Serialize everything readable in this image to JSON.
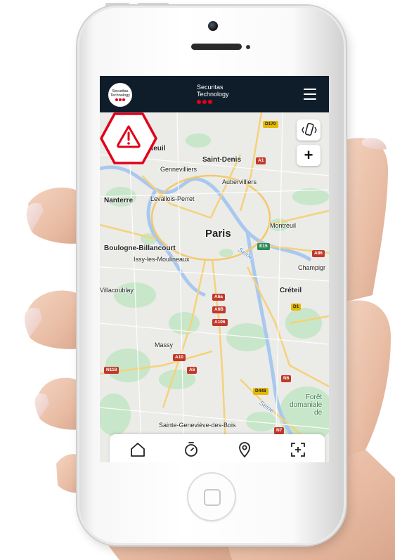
{
  "app": {
    "logo_text": "Securitas Technology",
    "brand_name": "Securitas\nTechnology",
    "brand_line1": "Securitas",
    "brand_line2": "Technology",
    "accent_color": "#e2001a",
    "header_color": "#0f1d2b"
  },
  "header": {
    "menu_icon": "hamburger-menu-icon"
  },
  "map": {
    "city_label": "Paris",
    "places": [
      "Argenteuil",
      "Saint-Denis",
      "Gennevilliers",
      "Aubervilliers",
      "Nanterre",
      "Levallois-Perret",
      "Montreuil",
      "Boulogne-Billancourt",
      "Issy-les-Moulineaux",
      "Champigr",
      "Villacoublay",
      "Créteil",
      "Massy",
      "Sainte-Geneviève-des-Bois",
      "Aubervilliers"
    ],
    "river": "Seine",
    "forest": "Forêt\ndomaniale\nde",
    "roads": [
      "D170",
      "A1",
      "E15",
      "A86",
      "A6a",
      "A6B",
      "A106",
      "D1",
      "A10",
      "A6",
      "N118",
      "N6",
      "D448",
      "N7"
    ],
    "controls": {
      "widgets_icon": "grid-plus-icon",
      "vibrate_icon": "phone-vibrate-icon",
      "zoom_in_label": "+",
      "locate_icon": "navigation-arrow-icon"
    }
  },
  "alert": {
    "icon": "warning-triangle-icon",
    "color": "#e2001a"
  },
  "bottom_nav": {
    "items": [
      {
        "icon": "home-icon"
      },
      {
        "icon": "timer-icon"
      },
      {
        "icon": "location-pin-icon"
      },
      {
        "icon": "scan-plus-icon"
      }
    ]
  }
}
